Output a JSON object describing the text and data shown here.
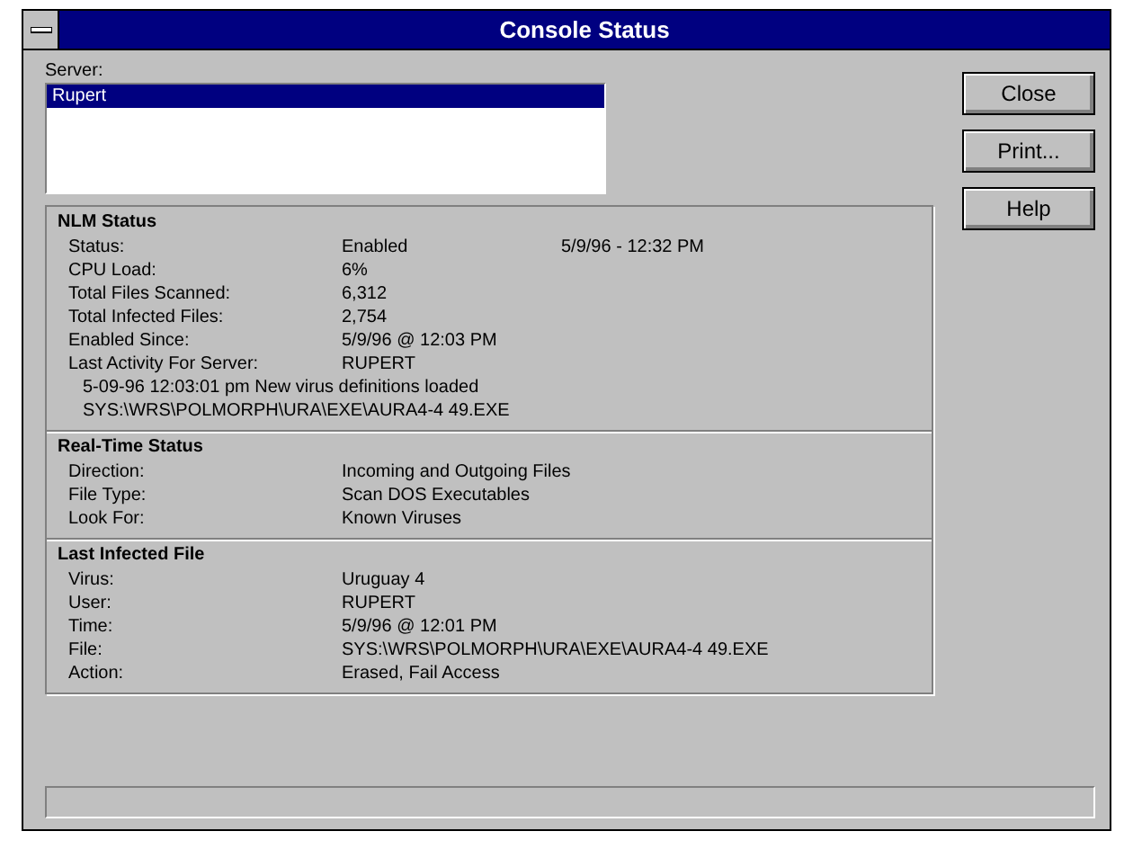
{
  "window": {
    "title": "Console Status"
  },
  "server": {
    "label": "Server:",
    "items": [
      {
        "label": "Rupert",
        "selected": true
      }
    ]
  },
  "buttons": [
    "Close",
    "Print...",
    "Help"
  ],
  "sections": [
    {
      "title": "NLM Status",
      "rows": [
        {
          "label": "Status:",
          "value": "Enabled",
          "extra": "5/9/96 - 12:32 PM"
        },
        {
          "label": "CPU Load:",
          "value": "6%"
        },
        {
          "label": "Total Files Scanned:",
          "value": "6,312"
        },
        {
          "label": "Total Infected Files:",
          "value": "2,754"
        },
        {
          "label": "Enabled Since:",
          "value": "5/9/96 @ 12:03 PM"
        },
        {
          "label": "Last Activity For Server:",
          "value": "RUPERT"
        }
      ],
      "notes": [
        "5-09-96 12:03:01 pm  New virus definitions loaded",
        "SYS:\\WRS\\POLMORPH\\URA\\EXE\\AURA4-4 49.EXE"
      ]
    },
    {
      "title": "Real-Time Status",
      "rows": [
        {
          "label": "Direction:",
          "value": "Incoming and Outgoing Files"
        },
        {
          "label": "File Type:",
          "value": "Scan DOS Executables"
        },
        {
          "label": "Look For:",
          "value": "Known Viruses"
        }
      ]
    },
    {
      "title": "Last Infected File",
      "rows": [
        {
          "label": "Virus:",
          "value": "Uruguay 4"
        },
        {
          "label": "User:",
          "value": "RUPERT"
        },
        {
          "label": "Time:",
          "value": "5/9/96 @ 12:01 PM"
        },
        {
          "label": "File:",
          "value": "SYS:\\WRS\\POLMORPH\\URA\\EXE\\AURA4-4 49.EXE"
        },
        {
          "label": "Action:",
          "value": "Erased, Fail Access"
        }
      ]
    }
  ]
}
